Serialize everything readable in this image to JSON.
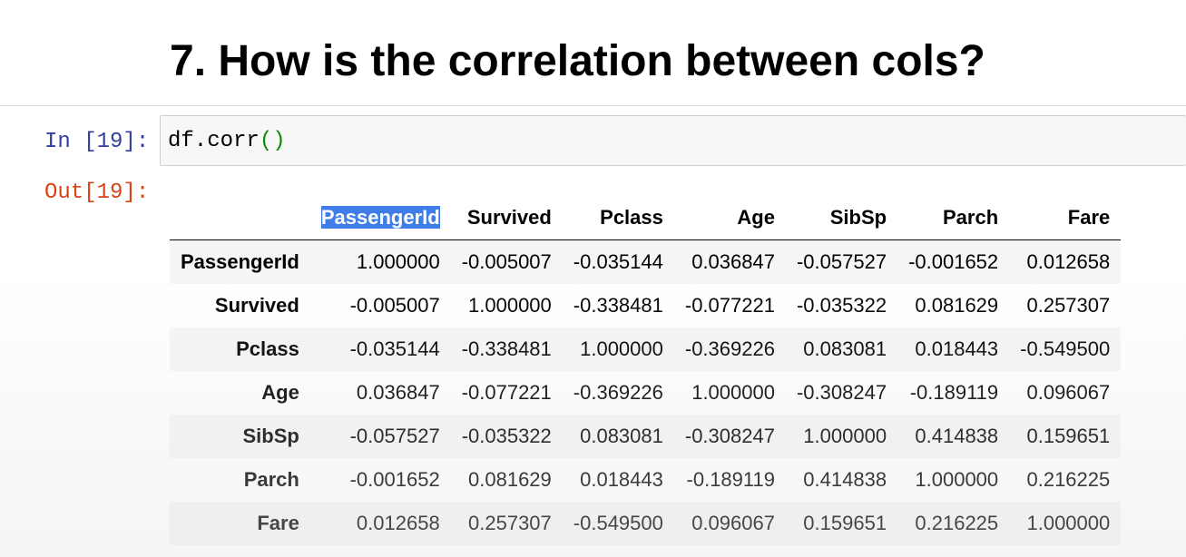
{
  "heading": "7. How is the correlation between cols?",
  "cell": {
    "in_prompt": "In [19]:",
    "out_prompt": "Out[19]:",
    "code_text": "df.corr",
    "code_open_paren": "(",
    "code_close_paren": ")"
  },
  "table": {
    "columns": [
      "PassengerId",
      "Survived",
      "Pclass",
      "Age",
      "SibSp",
      "Parch",
      "Fare"
    ],
    "rows": [
      {
        "label": "PassengerId",
        "values": [
          "1.000000",
          "-0.005007",
          "-0.035144",
          "0.036847",
          "-0.057527",
          "-0.001652",
          "0.012658"
        ]
      },
      {
        "label": "Survived",
        "values": [
          "-0.005007",
          "1.000000",
          "-0.338481",
          "-0.077221",
          "-0.035322",
          "0.081629",
          "0.257307"
        ]
      },
      {
        "label": "Pclass",
        "values": [
          "-0.035144",
          "-0.338481",
          "1.000000",
          "-0.369226",
          "0.083081",
          "0.018443",
          "-0.549500"
        ]
      },
      {
        "label": "Age",
        "values": [
          "0.036847",
          "-0.077221",
          "-0.369226",
          "1.000000",
          "-0.308247",
          "-0.189119",
          "0.096067"
        ]
      },
      {
        "label": "SibSp",
        "values": [
          "-0.057527",
          "-0.035322",
          "0.083081",
          "-0.308247",
          "1.000000",
          "0.414838",
          "0.159651"
        ]
      },
      {
        "label": "Parch",
        "values": [
          "-0.001652",
          "0.081629",
          "0.018443",
          "-0.189119",
          "0.414838",
          "1.000000",
          "0.216225"
        ]
      },
      {
        "label": "Fare",
        "values": [
          "0.012658",
          "0.257307",
          "-0.549500",
          "0.096067",
          "0.159651",
          "0.216225",
          "1.000000"
        ]
      }
    ],
    "selected_header": "PassengerId"
  },
  "colors": {
    "in_prompt": "#303f9f",
    "out_prompt": "#d84315",
    "selection": "#3f7de8",
    "paren": "#0b8a0b"
  }
}
